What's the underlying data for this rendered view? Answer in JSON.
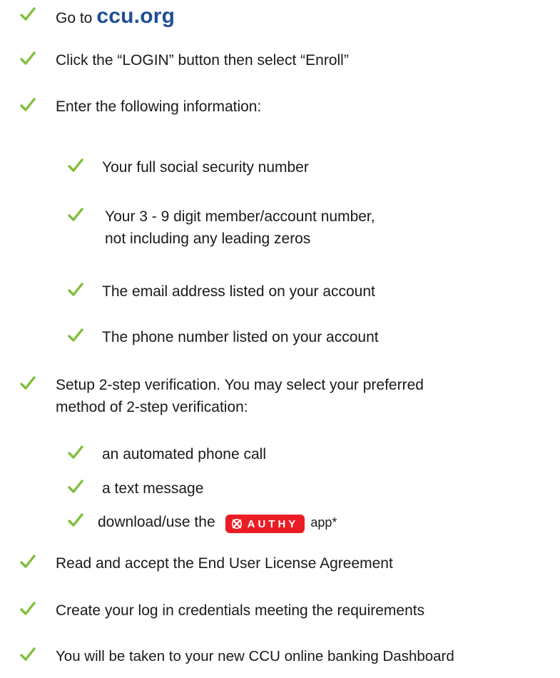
{
  "colors": {
    "check": "#7fbf3a",
    "link": "#1f4e96",
    "authy_badge": "#ec1c24"
  },
  "steps": {
    "goto_prefix": "Go to",
    "goto_link": "ccu.org",
    "login": "Click the “LOGIN” button then select “Enroll”",
    "enter_info": "Enter the following information:",
    "info_items": [
      "Your full social security number",
      "Your 3 - 9 digit member/account number, not including any leading zeros",
      "The email address listed on your account",
      "The phone number listed on your account"
    ],
    "verification_line1": "Setup 2-step verification. You may select your preferred",
    "verification_line2": "method of 2-step verification:",
    "verification_options": {
      "phone_call": "an automated phone call",
      "text_message": "a text message",
      "download_prefix": "download/use the",
      "authy_label": "AUTHY",
      "download_suffix": "app*"
    },
    "eula": "Read and accept the End User License Agreement",
    "credentials": "Create your log in credentials meeting the requirements",
    "dashboard": "You will be taken to your new CCU online banking Dashboard"
  }
}
